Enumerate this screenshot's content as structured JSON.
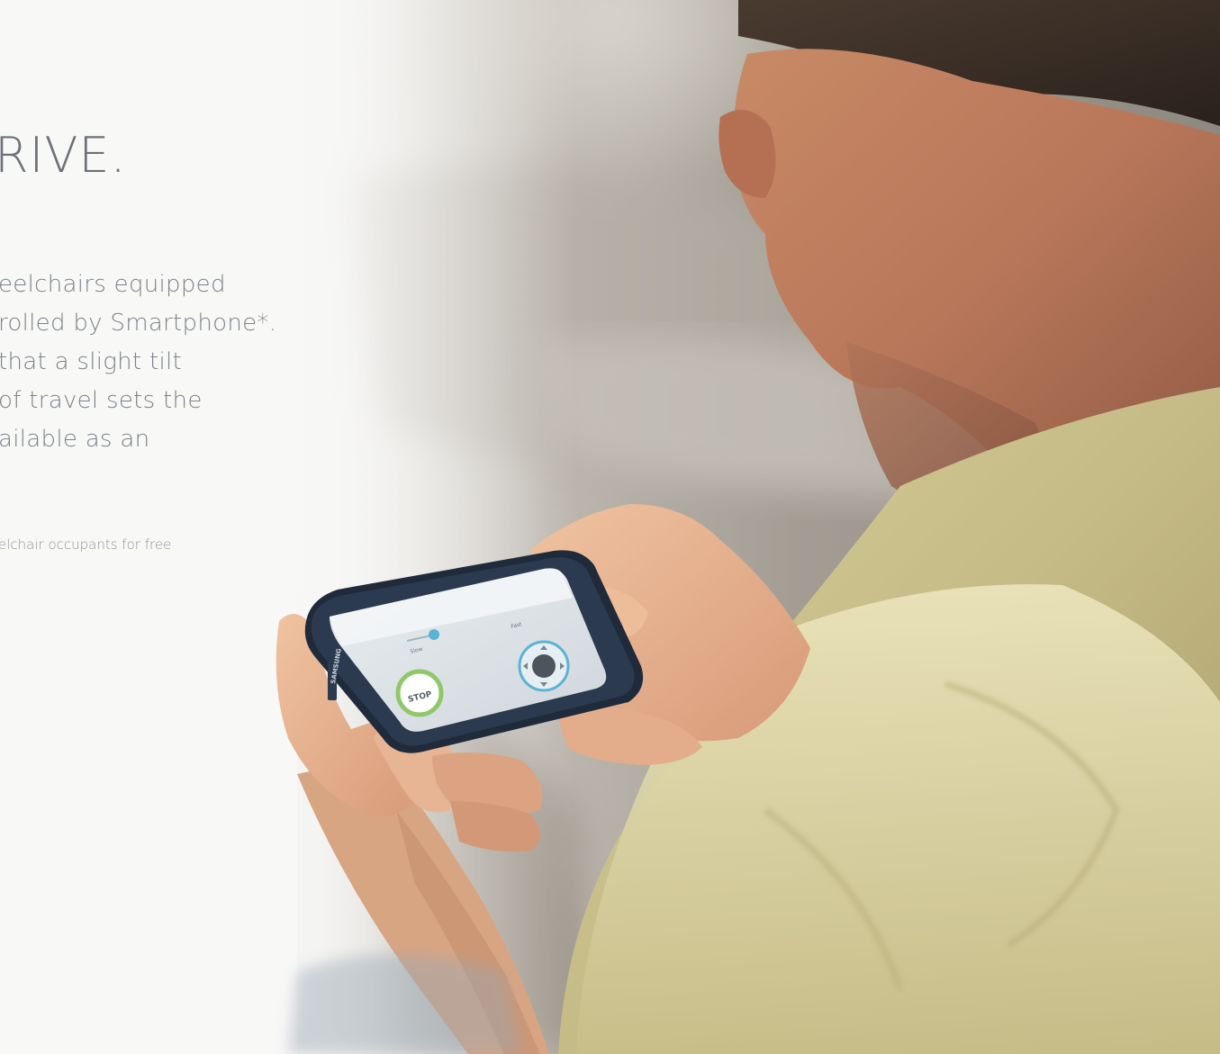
{
  "headline": "RIVE.",
  "body_lines": [
    "eelchairs equipped",
    "rolled by Smartphone*.",
    "that a slight tilt",
    "of travel sets the",
    "ailable as an"
  ],
  "footnote": "elchair occupants for free",
  "phone": {
    "brand": "SAMSUNG",
    "stop_label": "STOP",
    "slow_label": "Slow",
    "fast_label": "Fast"
  },
  "colors": {
    "headline": "#6b7278",
    "body_text": "#7c8389",
    "shirt": "#c9c08c",
    "phone_body": "#1e2a3a",
    "stop_ring": "#8fc86b",
    "joystick_ring": "#5bb3d6"
  }
}
